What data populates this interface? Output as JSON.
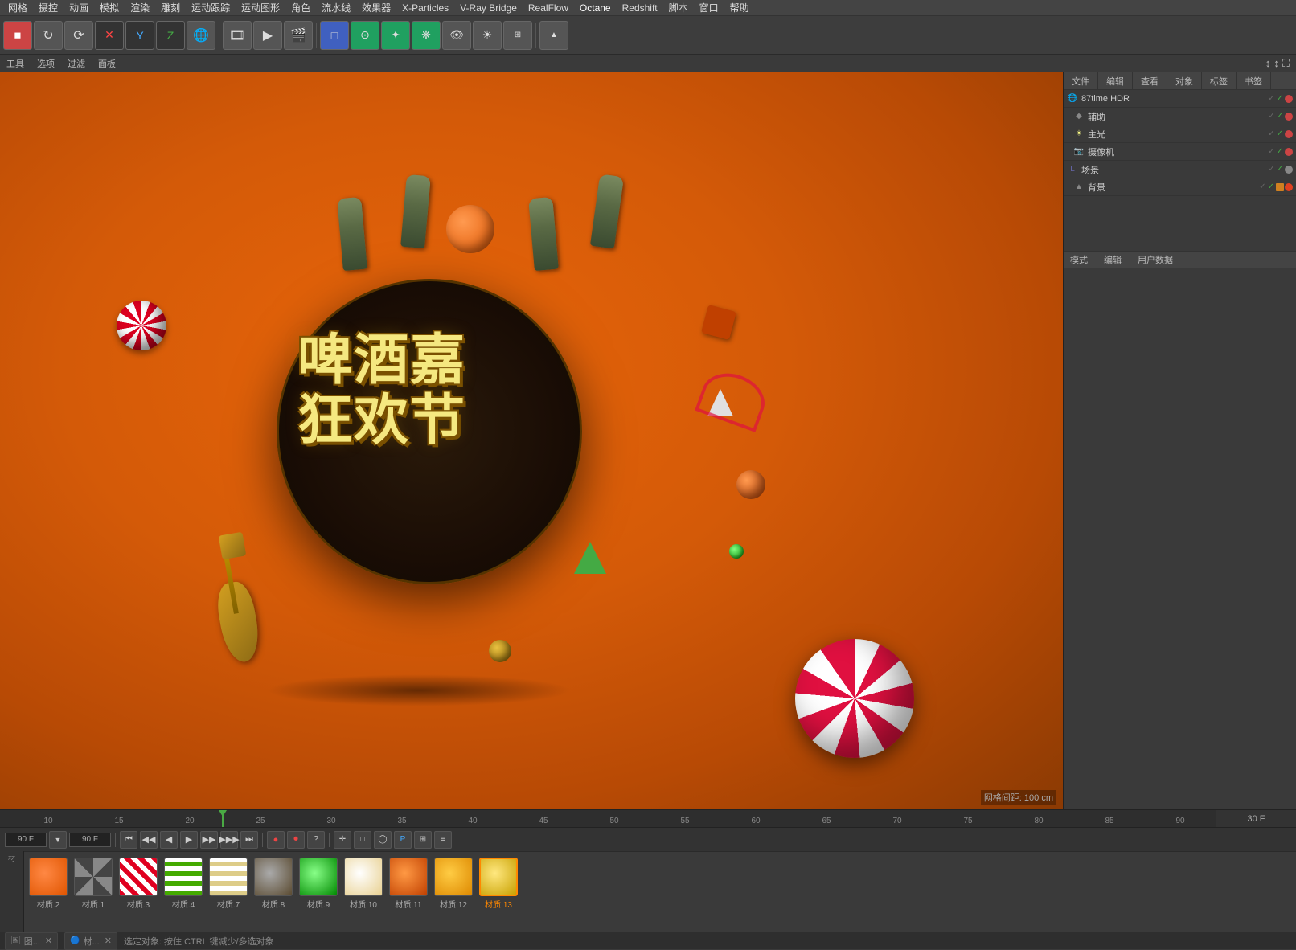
{
  "app": {
    "title": "Cinema 4D"
  },
  "menu": {
    "items": [
      "网格",
      "摄控",
      "动画",
      "模拟",
      "渲染",
      "雕刻",
      "运动跟踪",
      "运动图形",
      "角色",
      "流水线",
      "效果器",
      "X-Particles",
      "V-Ray Bridge",
      "RealFlow",
      "Octane",
      "Redshift",
      "脚本",
      "窗口",
      "帮助"
    ]
  },
  "secondary_toolbar": {
    "items": [
      "工具",
      "选项",
      "过滤",
      "面板"
    ]
  },
  "viewport": {
    "grid_label": "网格间距: 100 cm"
  },
  "scene_text_line1": "啤酒嘉",
  "scene_text_line2": "狂欢节",
  "object_manager": {
    "tabs": [
      "文件",
      "编辑",
      "查看",
      "对象",
      "标签",
      "书签"
    ],
    "objects": [
      {
        "id": "hdr",
        "name": "87time HDR",
        "indent": 0,
        "type": "hdr"
      },
      {
        "id": "aux",
        "name": "辅助",
        "indent": 1,
        "type": "obj"
      },
      {
        "id": "light",
        "name": "主光",
        "indent": 1,
        "type": "light"
      },
      {
        "id": "camera",
        "name": "摄像机",
        "indent": 1,
        "type": "camera"
      },
      {
        "id": "scene",
        "name": "场景",
        "indent": 0,
        "type": "scene",
        "has_child": true
      },
      {
        "id": "bg",
        "name": "背景",
        "indent": 1,
        "type": "bg"
      }
    ]
  },
  "attr_panel": {
    "tabs": [
      "模式",
      "编辑",
      "用户数据"
    ]
  },
  "timeline": {
    "ticks": [
      "10",
      "15",
      "20",
      "25",
      "30",
      "35",
      "40",
      "45",
      "50",
      "55",
      "60",
      "65",
      "70",
      "75",
      "80",
      "85",
      "90"
    ],
    "playhead_pos": "30",
    "current_frame": "90 F",
    "end_frame": "90 F",
    "fps": "30 F"
  },
  "playback": {
    "current_frame": "90 F",
    "end_frame": "90 F"
  },
  "materials": [
    {
      "id": "mat0",
      "label": "材质.2",
      "color": "#e05500",
      "type": "plain"
    },
    {
      "id": "mat1",
      "label": "材质.1",
      "color": "#888",
      "type": "checker"
    },
    {
      "id": "mat3",
      "label": "材质.3",
      "color": "#e00020",
      "type": "striped"
    },
    {
      "id": "mat4",
      "label": "材质.4",
      "color": "#44aa00",
      "type": "striped_g"
    },
    {
      "id": "mat7",
      "label": "材质.7",
      "color": "#ddcc88",
      "type": "striped_y"
    },
    {
      "id": "mat8",
      "label": "材质.8",
      "color": "#6a5a40",
      "type": "plain_d"
    },
    {
      "id": "mat9",
      "label": "材质.9",
      "color": "#44aa44",
      "type": "green"
    },
    {
      "id": "mat10",
      "label": "材质.10",
      "color": "#e8d090",
      "type": "cream"
    },
    {
      "id": "mat11",
      "label": "材质.11",
      "color": "#e05500",
      "type": "orange"
    },
    {
      "id": "mat12",
      "label": "材质.12",
      "color": "#dd8800",
      "type": "amber"
    },
    {
      "id": "mat_sel",
      "label": "材质.13",
      "color": "#e8c840",
      "type": "gold",
      "selected": true
    }
  ],
  "status": {
    "left_tabs": [
      "图...",
      "材..."
    ],
    "hint": "选定对象: 按住 CTRL 键减少/多选对象"
  }
}
